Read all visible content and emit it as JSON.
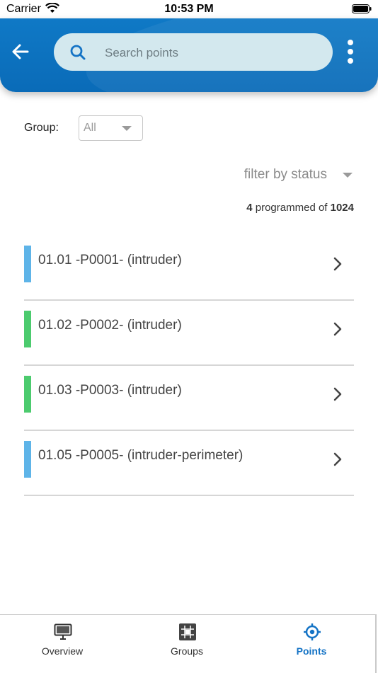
{
  "status_bar": {
    "carrier": "Carrier",
    "time": "10:53 PM"
  },
  "header": {
    "search_placeholder": "Search points",
    "back_icon": "arrow-left-icon",
    "search_icon": "search-icon",
    "more_icon": "more-vertical-icon"
  },
  "filters": {
    "group_label": "Group:",
    "group_value": "All",
    "status_placeholder": "filter by status"
  },
  "summary": {
    "programmed": "4",
    "text": " programmed of ",
    "total": "1024"
  },
  "points": [
    {
      "label": "01.01 -P0001- (intruder)",
      "color": "#5eb4e8"
    },
    {
      "label": "01.02 -P0002- (intruder)",
      "color": "#4ccb6e"
    },
    {
      "label": "01.03 -P0003- (intruder)",
      "color": "#4ccb6e"
    },
    {
      "label": "01.05 -P0005- (intruder-perimeter)",
      "color": "#5eb4e8"
    }
  ],
  "tabs": [
    {
      "label": "Overview",
      "icon": "monitor-icon",
      "active": false
    },
    {
      "label": "Groups",
      "icon": "grid-icon",
      "active": false
    },
    {
      "label": "Points",
      "icon": "crosshair-icon",
      "active": true
    }
  ],
  "colors": {
    "accent": "#1473c5",
    "header": "#0f79c6"
  }
}
